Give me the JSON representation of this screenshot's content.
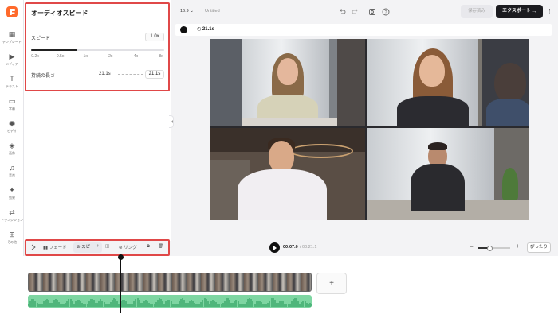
{
  "sidebar": {
    "items": [
      {
        "label": "テンプレート",
        "icon": "template-icon"
      },
      {
        "label": "メディア",
        "icon": "media-icon"
      },
      {
        "label": "テキスト",
        "icon": "text-icon"
      },
      {
        "label": "字幕",
        "icon": "subtitle-icon"
      },
      {
        "label": "ビデオ",
        "icon": "video-icon"
      },
      {
        "label": "画像",
        "icon": "image-icon"
      },
      {
        "label": "音楽",
        "icon": "music-icon"
      },
      {
        "label": "効果",
        "icon": "effects-icon"
      },
      {
        "label": "トランジション",
        "icon": "transition-icon"
      },
      {
        "label": "その他",
        "icon": "more-icon"
      }
    ]
  },
  "speed_panel": {
    "title": "オーディオスピード",
    "speed_label": "スピード",
    "speed_value": "1.0x",
    "speed_fraction": 0.35,
    "ticks": [
      "0.2x",
      "0.5x",
      "1x",
      "2x",
      "4x",
      "8x"
    ],
    "duration_label": "持続の長さ",
    "duration_from": "21.1s",
    "duration_to": "21.1s"
  },
  "topbar": {
    "aspect_ratio": "16:9",
    "project_title": "Untitled",
    "save_label": "保存済み",
    "export_label": "エクスポート",
    "export_arrow": "→",
    "more": "⋮"
  },
  "canvas": {
    "bg_color": "#111111",
    "duration": "21.1s"
  },
  "timeline_toolbar": {
    "fade": "フェード",
    "speed": "スピード",
    "ring": "リング"
  },
  "player": {
    "current_time": "00:07.0",
    "total_time": "/ 00:21.1",
    "zoom_minus": "−",
    "zoom_plus": "+",
    "zoom_fraction": 0.35,
    "fit_label": "ぴったり"
  },
  "timeline": {
    "add_label": "+"
  },
  "colors": {
    "accent": "#ff6a2b",
    "highlight": "#e04848",
    "audio": "#7ed6a2"
  }
}
